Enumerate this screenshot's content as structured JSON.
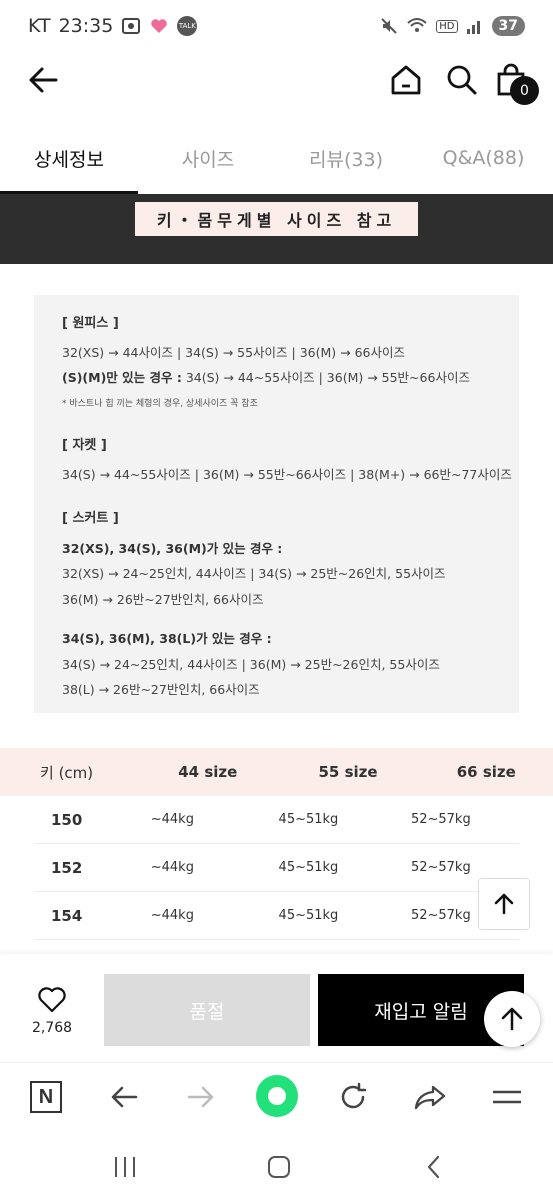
{
  "status": {
    "carrier": "KT",
    "time": "23:35",
    "battery": "37",
    "talk_badge": "TALK"
  },
  "nav": {
    "cart_count": "0"
  },
  "tabs": [
    {
      "label": "상세정보",
      "active": true
    },
    {
      "label": "사이즈",
      "active": false
    },
    {
      "label": "리뷰(33)",
      "active": false
    },
    {
      "label": "Q&A(88)",
      "active": false
    }
  ],
  "banner": {
    "label": "키・몸무게별 사이즈 참고"
  },
  "info": {
    "onepiece_heading": "[ 원피스 ]",
    "onepiece_line1": "32(XS) → 44사이즈  |  34(S) → 55사이즈  |  36(M) → 66사이즈",
    "onepiece_line2_bold": "(S)(M)만 있는 경우 :",
    "onepiece_line2": " 34(S) → 44~55사이즈  |  36(M) → 55반~66사이즈",
    "onepiece_note": "* 바스트나 힙 끼는 체형의 경우, 상세사이즈 꼭 참조",
    "jacket_heading": "[ 자켓 ]",
    "jacket_line1": "34(S) → 44~55사이즈  |  36(M) → 55반~66사이즈  |  38(M+) → 66반~77사이즈",
    "skirt_heading": "[ 스커트 ]",
    "skirt_case1": "32(XS), 34(S), 36(M)가 있는 경우 :",
    "skirt_case1_line1": "32(XS) → 24~25인치, 44사이즈  |  34(S) → 25반~26인치, 55사이즈",
    "skirt_case1_line2": "36(M) → 26반~27반인치, 66사이즈",
    "skirt_case2": "34(S), 36(M), 38(L)가 있는 경우 :",
    "skirt_case2_line1": "34(S) → 24~25인치, 44사이즈  |  36(M) → 25반~26인치, 55사이즈",
    "skirt_case2_line2": "38(L) → 26반~27반인치, 66사이즈"
  },
  "table": {
    "headers": [
      "키 (cm)",
      "44 size",
      "55 size",
      "66 size"
    ],
    "rows": [
      [
        "150",
        "~44kg",
        "45~51kg",
        "52~57kg"
      ],
      [
        "152",
        "~44kg",
        "45~51kg",
        "52~57kg"
      ],
      [
        "154",
        "~44kg",
        "45~51kg",
        "52~57kg"
      ]
    ]
  },
  "buybar": {
    "like_count": "2,768",
    "soldout_label": "품절",
    "restock_label": "재입고 알림"
  },
  "browser": {
    "brand_letter": "N"
  },
  "colors": {
    "accent_bg": "#fbeeea",
    "banner_bg": "#2e2e2e",
    "green": "#22c55e"
  }
}
